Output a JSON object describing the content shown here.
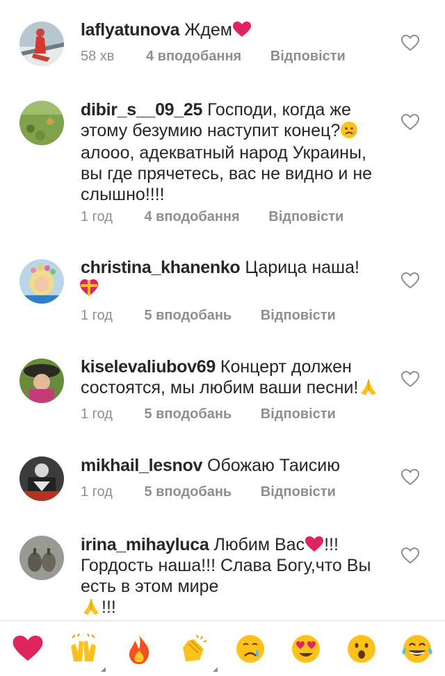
{
  "comments": [
    {
      "username": "laflyatunova",
      "text": "Ждем",
      "emoji": "heart",
      "time": "58 хв",
      "likes": "4 вподобання",
      "reply": "Відповісти",
      "avatar": "avatar-woman-red-boat"
    },
    {
      "username": "dibir_s__09_25",
      "text": "Господи, когда же этому безумию наступит конец?",
      "emoji": "sad-face",
      "text2": "алооо, адекватный народ Украины, вы где прячетесь, вас не видно и не слышно!!!!",
      "time": "1 год",
      "likes": "4 вподобання",
      "reply": "Відповісти",
      "avatar": "avatar-green-field"
    },
    {
      "username": "christina_khanenko",
      "text": "Царица наша!",
      "emoji": "gift-heart",
      "time": "1 год",
      "likes": "5 вподобань",
      "reply": "Відповісти",
      "avatar": "avatar-blonde-flowers"
    },
    {
      "username": "kiselevaliubov69",
      "text": "Концерт должен состоятся, мы любим ваши песни!",
      "emoji": "folded-hands",
      "time": "1 год",
      "likes": "5 вподобань",
      "reply": "Відповісти",
      "avatar": "avatar-woman-hat"
    },
    {
      "username": "mikhail_lesnov",
      "text": "Обожаю Таисию",
      "time": "1 год",
      "likes": "5 вподобань",
      "reply": "Відповісти",
      "avatar": "avatar-dark-tshirt"
    },
    {
      "username": "irina_mihayluca",
      "text": "Любим Вас",
      "emoji": "heart",
      "text2": "!!! Гордость наша!!! Слава Богу,что Вы есть в этом мире",
      "text3": "!!!",
      "avatar": "avatar-gray-objects"
    }
  ],
  "quick_reactions": [
    "heart-emoji",
    "raising-hands-emoji",
    "fire-emoji",
    "clapping-hands-emoji",
    "crying-face-emoji",
    "heart-eyes-emoji",
    "surprised-face-emoji",
    "tears-of-joy-emoji"
  ],
  "colors": {
    "text": "#262626",
    "meta": "#8e8e8e",
    "heart": "#e0245e",
    "divider": "#dbdbdb"
  }
}
